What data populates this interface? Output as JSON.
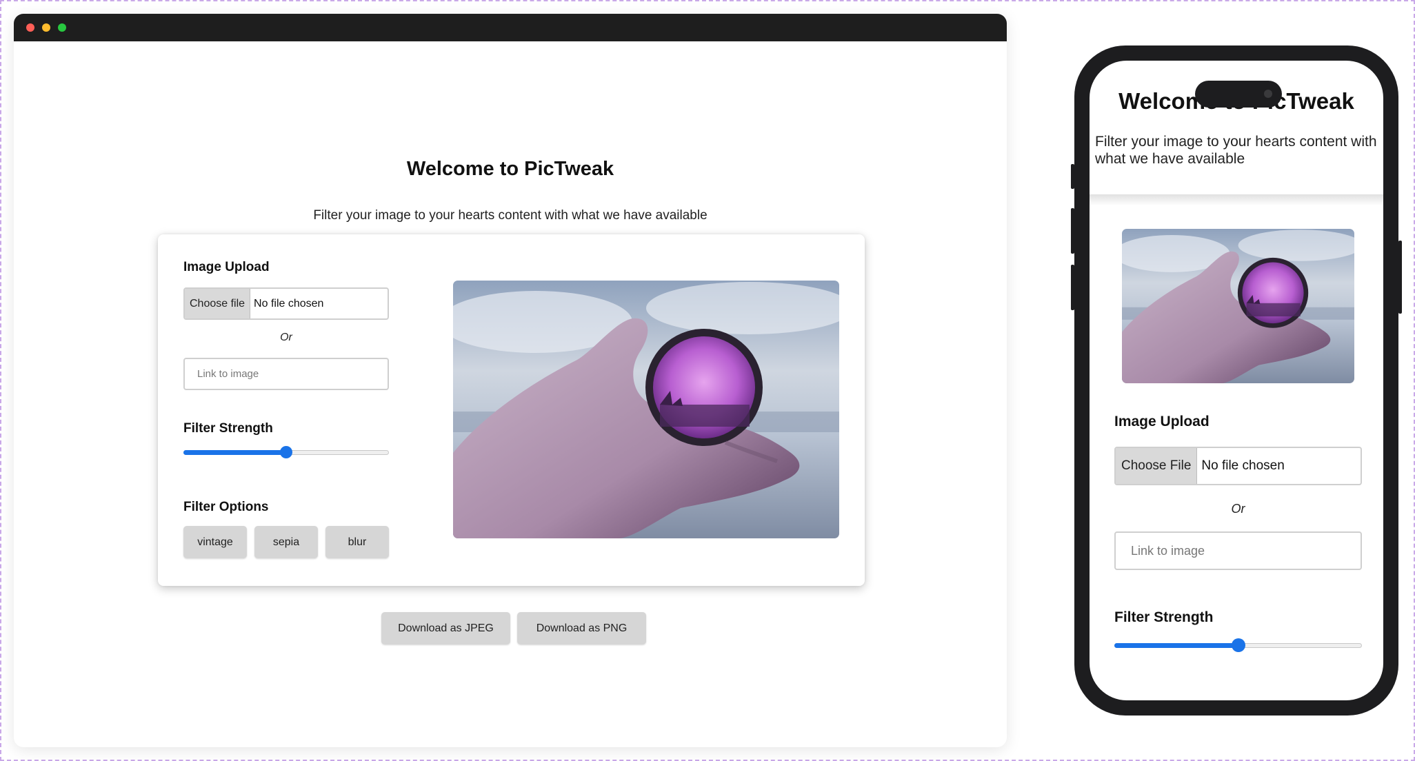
{
  "desktop": {
    "title": "Welcome to PicTweak",
    "subtitle": "Filter your image to your hearts content with what we have available",
    "image_upload_label": "Image Upload",
    "file_button": "Choose file",
    "file_status": "No file chosen",
    "or_text": "Or",
    "link_placeholder": "Link to image",
    "filter_strength_label": "Filter Strength",
    "filter_strength_value": 0.5,
    "filter_options_label": "Filter Options",
    "filter_options": [
      "vintage",
      "sepia",
      "blur"
    ],
    "download_jpeg": "Download as JPEG",
    "download_png": "Download as PNG"
  },
  "mobile": {
    "title": "Welcome to PicTweak",
    "subtitle": "Filter your image to your hearts content with what we have available",
    "image_upload_label": "Image Upload",
    "file_button": "Choose File",
    "file_status": "No file chosen",
    "or_text": "Or",
    "link_placeholder": "Link to image",
    "filter_strength_label": "Filter Strength",
    "filter_strength_value": 0.5
  },
  "colors": {
    "accent": "#1a73e8",
    "button_bg": "#d6d6d6",
    "titlebar": "#1e1e1e",
    "phone_frame": "#1d1d1f"
  },
  "icons": [
    "window-close-dot",
    "window-minimize-dot",
    "window-maximize-dot"
  ]
}
